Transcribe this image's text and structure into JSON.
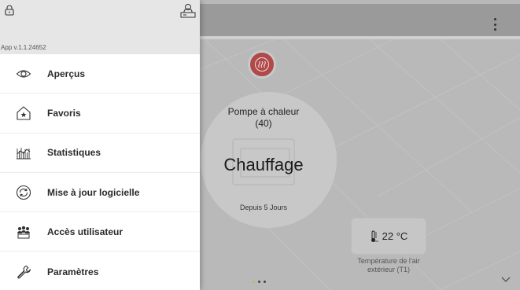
{
  "drawer": {
    "app_version": "App v.1.1.24652",
    "items": [
      {
        "label": "Aperçus",
        "icon": "eye-icon"
      },
      {
        "label": "Favoris",
        "icon": "home-star-icon"
      },
      {
        "label": "Statistiques",
        "icon": "statistics-icon"
      },
      {
        "label": "Mise à jour logicielle",
        "icon": "software-update-icon"
      },
      {
        "label": "Accès utilisateur",
        "icon": "user-access-icon"
      },
      {
        "label": "Paramètres",
        "icon": "wrench-icon"
      }
    ]
  },
  "status": {
    "device_title": "Pompe à chaleur\n(40)",
    "mode": "Chauffage",
    "since": "Depuis 5 Jours"
  },
  "outdoor": {
    "temperature": "22 °C",
    "label": "Température de l'air extérieur (T1)"
  },
  "pager": {
    "count": 3,
    "active": 0
  },
  "colors": {
    "heat_button": "#b04949",
    "drawer_bg": "#ffffff",
    "drawer_header": "#e6e6e6",
    "pager_active": "#c9b64a"
  }
}
